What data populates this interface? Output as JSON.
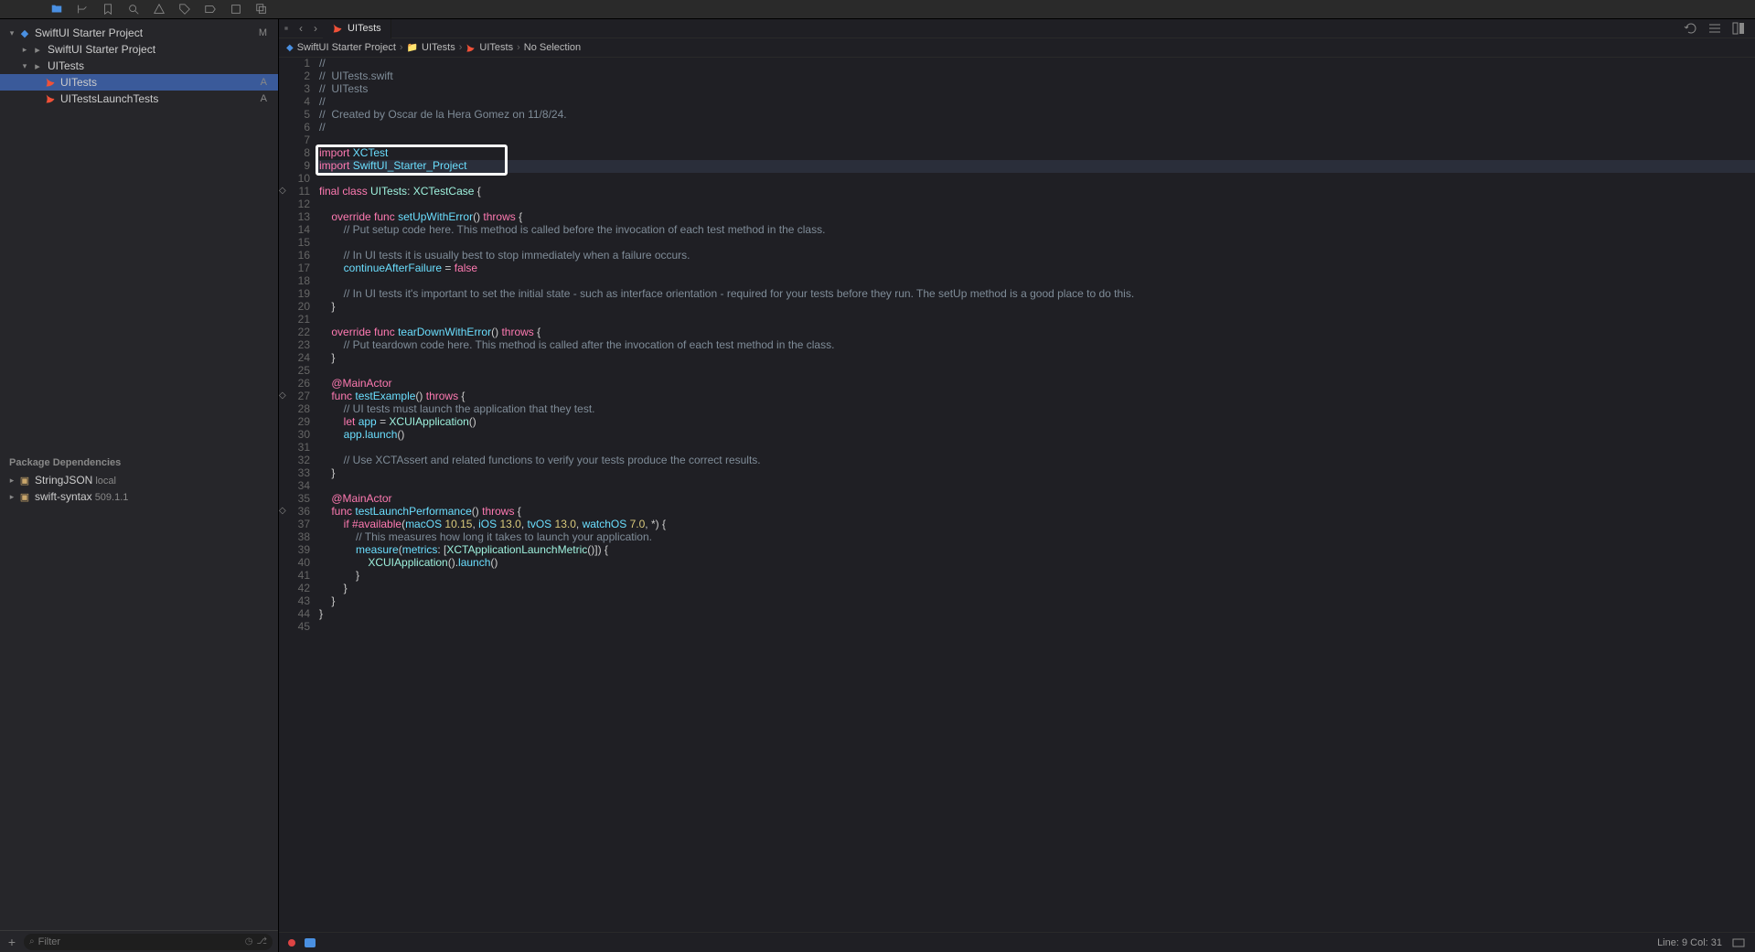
{
  "toolbar": {
    "icons": [
      "folder",
      "vcs",
      "bookmark",
      "search",
      "warning",
      "tag",
      "run",
      "debug",
      "layers"
    ]
  },
  "sidebar": {
    "project_name": "SwiftUI Starter Project",
    "project_badge": "M",
    "tree": [
      {
        "indent": 0,
        "kind": "project",
        "label": "SwiftUI Starter Project",
        "badge": "M",
        "open": true
      },
      {
        "indent": 1,
        "kind": "folder",
        "label": "SwiftUI Starter Project",
        "open": false,
        "disclosure": true
      },
      {
        "indent": 1,
        "kind": "folder",
        "label": "UITests",
        "open": true,
        "disclosure": true
      },
      {
        "indent": 2,
        "kind": "swift",
        "label": "UITests",
        "badge": "A",
        "selected": true
      },
      {
        "indent": 2,
        "kind": "swift",
        "label": "UITestsLaunchTests",
        "badge": "A"
      }
    ],
    "packages_header": "Package Dependencies",
    "packages": [
      {
        "name": "StringJSON",
        "meta": "local"
      },
      {
        "name": "swift-syntax",
        "meta": "509.1.1"
      }
    ],
    "filter_placeholder": "Filter"
  },
  "editor_toolbar": {
    "tab_label": "UITests",
    "right_icons": [
      "refresh",
      "adjust",
      "assistant"
    ]
  },
  "jump_bar": [
    "SwiftUI Starter Project",
    "UITests",
    "UITests",
    "No Selection"
  ],
  "status": {
    "line_col": "Line: 9  Col: 31"
  },
  "code": {
    "highlight_line": 9,
    "outline_lines": [
      8,
      9
    ],
    "diamond_lines": [
      11,
      27,
      36
    ],
    "lines": [
      [
        [
          "com",
          "//"
        ]
      ],
      [
        [
          "com",
          "//  UITests.swift"
        ]
      ],
      [
        [
          "com",
          "//  UITests"
        ]
      ],
      [
        [
          "com",
          "//"
        ]
      ],
      [
        [
          "com",
          "//  Created by Oscar de la Hera Gomez on 11/8/24."
        ]
      ],
      [
        [
          "com",
          "//"
        ]
      ],
      [],
      [
        [
          "kw",
          "import"
        ],
        [
          "p",
          " "
        ],
        [
          "id",
          "XCTest"
        ]
      ],
      [
        [
          "kw",
          "import"
        ],
        [
          "p",
          " "
        ],
        [
          "id",
          "SwiftUI_Starter_Project"
        ]
      ],
      [],
      [
        [
          "kw",
          "final"
        ],
        [
          "p",
          " "
        ],
        [
          "kw",
          "class"
        ],
        [
          "p",
          " "
        ],
        [
          "type",
          "UITests"
        ],
        [
          "p",
          ": "
        ],
        [
          "type",
          "XCTestCase"
        ],
        [
          "p",
          " {"
        ]
      ],
      [],
      [
        [
          "p",
          "    "
        ],
        [
          "kw",
          "override"
        ],
        [
          "p",
          " "
        ],
        [
          "kw",
          "func"
        ],
        [
          "p",
          " "
        ],
        [
          "func",
          "setUpWithError"
        ],
        [
          "p",
          "() "
        ],
        [
          "kw",
          "throws"
        ],
        [
          "p",
          " {"
        ]
      ],
      [
        [
          "p",
          "        "
        ],
        [
          "com",
          "// Put setup code here. This method is called before the invocation of each test method in the class."
        ]
      ],
      [],
      [
        [
          "p",
          "        "
        ],
        [
          "com",
          "// In UI tests it is usually best to stop immediately when a failure occurs."
        ]
      ],
      [
        [
          "p",
          "        "
        ],
        [
          "id",
          "continueAfterFailure"
        ],
        [
          "p",
          " = "
        ],
        [
          "bool",
          "false"
        ]
      ],
      [],
      [
        [
          "p",
          "        "
        ],
        [
          "com",
          "// In UI tests it's important to set the initial state - such as interface orientation - required for your tests before they run. The setUp method is a good place to do this."
        ]
      ],
      [
        [
          "p",
          "    }"
        ]
      ],
      [],
      [
        [
          "p",
          "    "
        ],
        [
          "kw",
          "override"
        ],
        [
          "p",
          " "
        ],
        [
          "kw",
          "func"
        ],
        [
          "p",
          " "
        ],
        [
          "func",
          "tearDownWithError"
        ],
        [
          "p",
          "() "
        ],
        [
          "kw",
          "throws"
        ],
        [
          "p",
          " {"
        ]
      ],
      [
        [
          "p",
          "        "
        ],
        [
          "com",
          "// Put teardown code here. This method is called after the invocation of each test method in the class."
        ]
      ],
      [
        [
          "p",
          "    }"
        ]
      ],
      [],
      [
        [
          "p",
          "    "
        ],
        [
          "attr",
          "@MainActor"
        ]
      ],
      [
        [
          "p",
          "    "
        ],
        [
          "kw",
          "func"
        ],
        [
          "p",
          " "
        ],
        [
          "func",
          "testExample"
        ],
        [
          "p",
          "() "
        ],
        [
          "kw",
          "throws"
        ],
        [
          "p",
          " {"
        ]
      ],
      [
        [
          "p",
          "        "
        ],
        [
          "com",
          "// UI tests must launch the application that they test."
        ]
      ],
      [
        [
          "p",
          "        "
        ],
        [
          "kw",
          "let"
        ],
        [
          "p",
          " "
        ],
        [
          "id",
          "app"
        ],
        [
          "p",
          " = "
        ],
        [
          "type",
          "XCUIApplication"
        ],
        [
          "p",
          "()"
        ]
      ],
      [
        [
          "p",
          "        "
        ],
        [
          "id",
          "app"
        ],
        [
          "p",
          "."
        ],
        [
          "func",
          "launch"
        ],
        [
          "p",
          "()"
        ]
      ],
      [],
      [
        [
          "p",
          "        "
        ],
        [
          "com",
          "// Use XCTAssert and related functions to verify your tests produce the correct results."
        ]
      ],
      [
        [
          "p",
          "    }"
        ]
      ],
      [],
      [
        [
          "p",
          "    "
        ],
        [
          "attr",
          "@MainActor"
        ]
      ],
      [
        [
          "p",
          "    "
        ],
        [
          "kw",
          "func"
        ],
        [
          "p",
          " "
        ],
        [
          "func",
          "testLaunchPerformance"
        ],
        [
          "p",
          "() "
        ],
        [
          "kw",
          "throws"
        ],
        [
          "p",
          " {"
        ]
      ],
      [
        [
          "p",
          "        "
        ],
        [
          "kw",
          "if"
        ],
        [
          "p",
          " "
        ],
        [
          "kw",
          "#available"
        ],
        [
          "p",
          "("
        ],
        [
          "id",
          "macOS"
        ],
        [
          "p",
          " "
        ],
        [
          "num",
          "10.15"
        ],
        [
          "p",
          ", "
        ],
        [
          "id",
          "iOS"
        ],
        [
          "p",
          " "
        ],
        [
          "num",
          "13.0"
        ],
        [
          "p",
          ", "
        ],
        [
          "id",
          "tvOS"
        ],
        [
          "p",
          " "
        ],
        [
          "num",
          "13.0"
        ],
        [
          "p",
          ", "
        ],
        [
          "id",
          "watchOS"
        ],
        [
          "p",
          " "
        ],
        [
          "num",
          "7.0"
        ],
        [
          "p",
          ", *) {"
        ]
      ],
      [
        [
          "p",
          "            "
        ],
        [
          "com",
          "// This measures how long it takes to launch your application."
        ]
      ],
      [
        [
          "p",
          "            "
        ],
        [
          "func",
          "measure"
        ],
        [
          "p",
          "("
        ],
        [
          "id",
          "metrics"
        ],
        [
          "p",
          ": ["
        ],
        [
          "type",
          "XCTApplicationLaunchMetric"
        ],
        [
          "p",
          "()]) {"
        ]
      ],
      [
        [
          "p",
          "                "
        ],
        [
          "type",
          "XCUIApplication"
        ],
        [
          "p",
          "()."
        ],
        [
          "func",
          "launch"
        ],
        [
          "p",
          "()"
        ]
      ],
      [
        [
          "p",
          "            }"
        ]
      ],
      [
        [
          "p",
          "        }"
        ]
      ],
      [
        [
          "p",
          "    }"
        ]
      ],
      [
        [
          "p",
          "}"
        ]
      ],
      []
    ]
  }
}
